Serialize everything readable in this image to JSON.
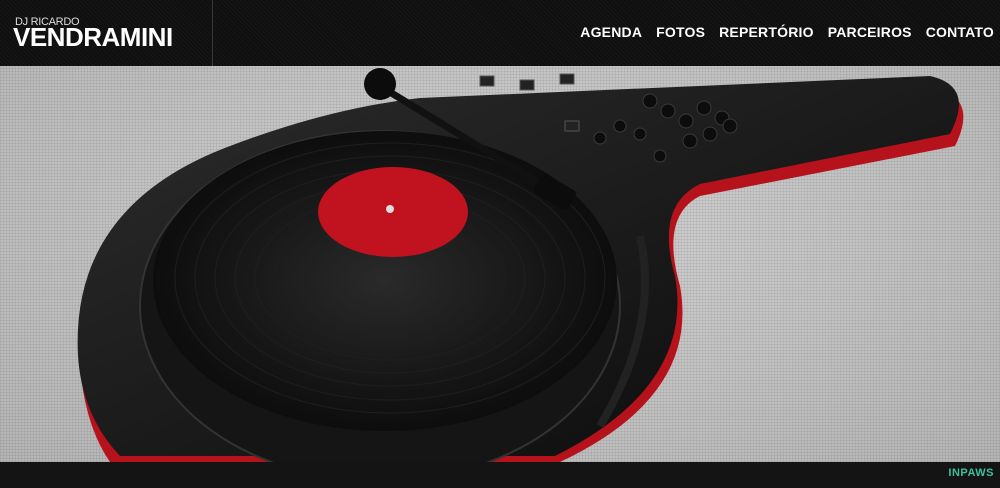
{
  "brand": {
    "small": "DJ RICARDO",
    "big": "VENDRAMINI"
  },
  "nav": [
    {
      "label": "AGENDA"
    },
    {
      "label": "FOTOS"
    },
    {
      "label": "REPERTÓRIO"
    },
    {
      "label": "PARCEIROS"
    },
    {
      "label": "CONTATO"
    }
  ],
  "hero": {
    "image": "dj-turntable-mixer-photo",
    "accent": "#c1121f"
  },
  "footer": {
    "credit_logo": "INPAWS"
  }
}
